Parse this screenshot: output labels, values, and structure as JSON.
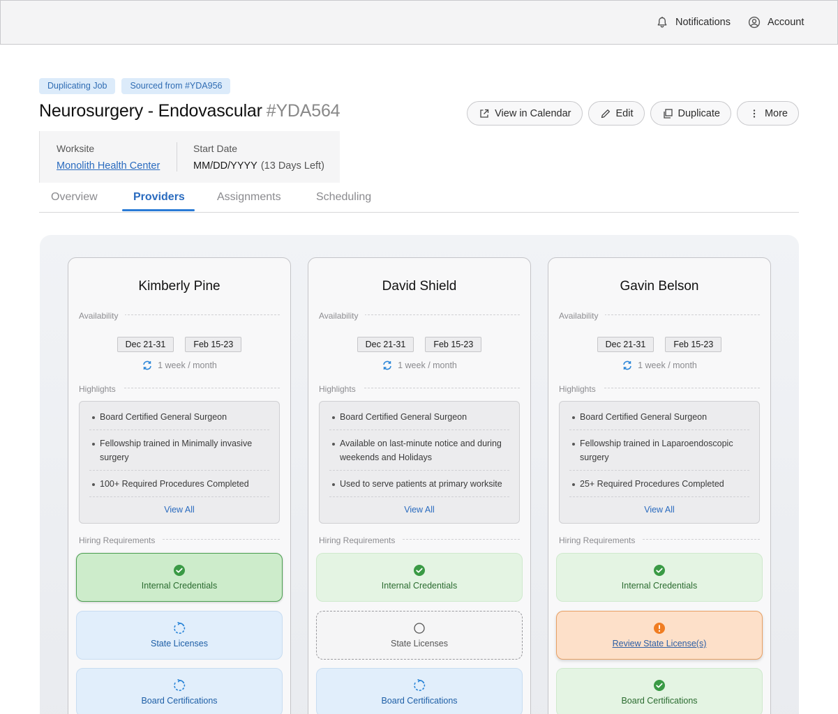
{
  "topbar": {
    "notifications_label": "Notifications",
    "account_label": "Account"
  },
  "job": {
    "tags": [
      "Duplicating Job",
      "Sourced from #YDA956"
    ],
    "title": "Neurosurgery - Endovascular",
    "id": "#YDA564",
    "worksite_label": "Worksite",
    "worksite_value": "Monolith Health Center",
    "start_label": "Start Date",
    "start_value": "MM/DD/YYYY",
    "start_sub": "(13 Days Left)"
  },
  "actions": {
    "calendar": "View in Calendar",
    "edit": "Edit",
    "duplicate": "Duplicate",
    "more": "More"
  },
  "tabs": [
    "Overview",
    "Providers",
    "Assignments",
    "Scheduling"
  ],
  "active_tab": "Providers",
  "labels": {
    "availability": "Availability",
    "highlights": "Highlights",
    "hiring": "Hiring Requirements",
    "view_all": "View All"
  },
  "providers": [
    {
      "name": "Kimberly Pine",
      "dates": [
        "Dec 21-31",
        "Feb 15-23"
      ],
      "frequency": "1 week / month",
      "highlights": [
        "Board Certified General Surgeon",
        "Fellowship trained in Minimally invasive surgery",
        "100+ Required Procedures Completed"
      ],
      "requirements": [
        {
          "label": "Internal Credentials",
          "status": "complete-selected"
        },
        {
          "label": "State Licenses",
          "status": "in-progress"
        },
        {
          "label": "Board Certifications",
          "status": "in-progress"
        }
      ]
    },
    {
      "name": "David Shield",
      "dates": [
        "Dec 21-31",
        "Feb 15-23"
      ],
      "frequency": "1 week / month",
      "highlights": [
        "Board Certified General Surgeon",
        "Available on last-minute notice and during weekends and Holidays",
        "Used to serve patients at primary worksite"
      ],
      "requirements": [
        {
          "label": "Internal Credentials",
          "status": "complete"
        },
        {
          "label": "State Licenses",
          "status": "not-started"
        },
        {
          "label": "Board Certifications",
          "status": "in-progress"
        }
      ]
    },
    {
      "name": "Gavin Belson",
      "dates": [
        "Dec 21-31",
        "Feb 15-23"
      ],
      "frequency": "1 week / month",
      "highlights": [
        "Board Certified General Surgeon",
        "Fellowship trained in Laparoendoscopic surgery",
        "25+ Required Procedures Completed"
      ],
      "requirements": [
        {
          "label": "Internal Credentials",
          "status": "complete"
        },
        {
          "label": "Review State License(s)",
          "status": "attention"
        },
        {
          "label": "Board Certifications",
          "status": "complete"
        }
      ]
    }
  ],
  "colors": {
    "accent": "#2a6bbf",
    "complete": "#3a9a45",
    "in_progress": "#2a85d8",
    "attention": "#f07d22"
  }
}
